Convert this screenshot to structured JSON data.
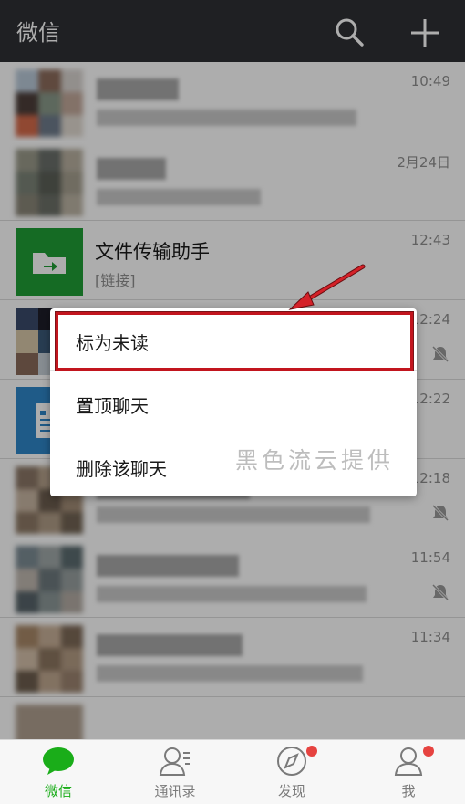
{
  "topbar": {
    "title": "微信",
    "icons": [
      "search-icon",
      "plus-icon"
    ]
  },
  "chats": [
    {
      "time": "10:49",
      "avatar_colors": [
        "#b9c9d8",
        "#8c6c5c",
        "#d8d3cf",
        "#4d3f3a",
        "#8a9a8a",
        "#c2a89a",
        "#d46a4a",
        "#6f7c8c",
        "#e0d9d0"
      ]
    },
    {
      "time": "2月24日",
      "avatar_colors": [
        "#9a9a8a",
        "#6a6f6a",
        "#b8b0a0",
        "#7c8478",
        "#5c6058",
        "#a6a090",
        "#8a8678",
        "#6c7068",
        "#bcb4a4"
      ]
    },
    {
      "name": "文件传输助手",
      "message": "[链接]",
      "time": "12:43",
      "avatar_color": "#1f9e35"
    },
    {
      "time": "12:24",
      "muted": true
    },
    {
      "time": "12:22",
      "avatar_color": "#2f86c9"
    },
    {
      "time": "12:18",
      "muted": true,
      "avatar_colors": [
        "#8b7766",
        "#b8a48e",
        "#7a6652",
        "#c8b6a2",
        "#6c5d4f",
        "#a48e78",
        "#8e7a66",
        "#b09c86",
        "#726454"
      ]
    },
    {
      "time": "11:54",
      "muted": true,
      "avatar_colors": [
        "#7c8c94",
        "#a0a8a8",
        "#5c6c70",
        "#c0b8b0",
        "#6e7a7e",
        "#98a0a0",
        "#58646a",
        "#8c9898",
        "#b4aca4"
      ]
    },
    {
      "time": "11:34",
      "avatar_colors": [
        "#a88868",
        "#c8b098",
        "#7e6a58",
        "#d4c0aa",
        "#8c7660",
        "#b49c84",
        "#6e5e4e",
        "#c0a890",
        "#9c8470"
      ]
    }
  ],
  "context_menu": {
    "items": [
      {
        "label": "标为未读",
        "highlighted": true
      },
      {
        "label": "置顶聊天"
      },
      {
        "label": "删除该聊天"
      }
    ]
  },
  "watermark": "黑色流云提供",
  "colors": {
    "accent": "#1aad19",
    "highlight_border": "#c2151e",
    "badge": "#e64340",
    "topbar": "#2f3034"
  },
  "tabbar": {
    "tabs": [
      {
        "label": "微信",
        "icon": "chat-icon",
        "active": true
      },
      {
        "label": "通讯录",
        "icon": "contacts-icon"
      },
      {
        "label": "发现",
        "icon": "compass-icon",
        "badge": true
      },
      {
        "label": "我",
        "icon": "profile-icon",
        "badge": true
      }
    ]
  }
}
